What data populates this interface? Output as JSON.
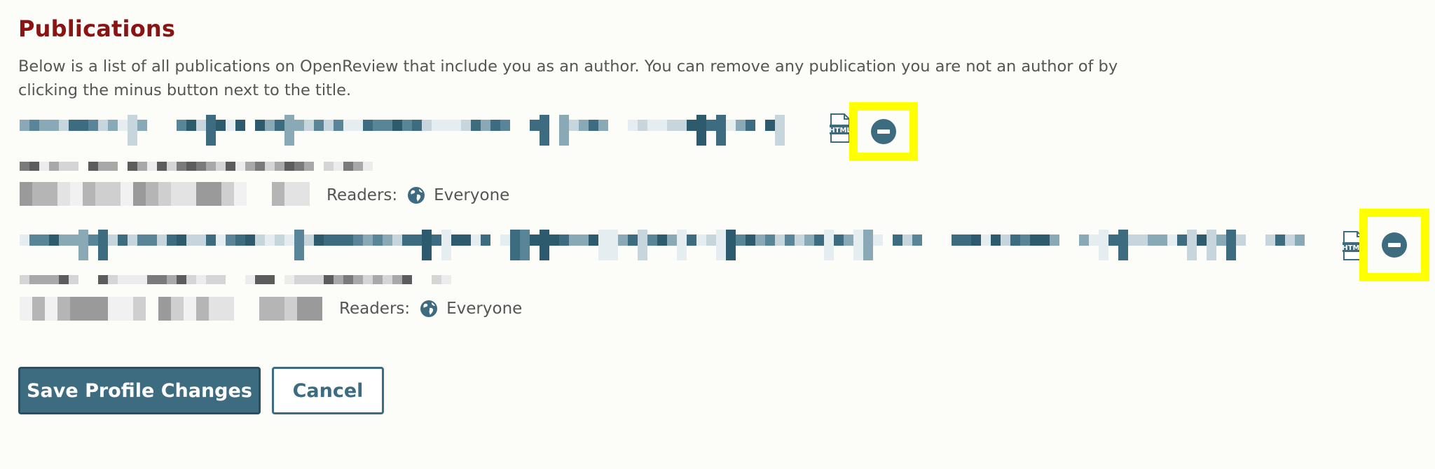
{
  "section": {
    "title": "Publications",
    "description": "Below is a list of all publications on OpenReview that include you as an author. You can remove any publication you are not an author of by clicking the minus button next to the title."
  },
  "publications": [
    {
      "title_redacted": true,
      "authors_redacted": true,
      "venue_redacted": true,
      "readers_label": "Readers:",
      "readers_value": "Everyone",
      "html_icon_label": "HTML",
      "remove_icon": "minus-circle-icon",
      "highlighted": true
    },
    {
      "title_redacted": true,
      "authors_redacted": true,
      "venue_redacted": true,
      "readers_label": "Readers:",
      "readers_value": "Everyone",
      "html_icon_label": "HTML",
      "remove_icon": "minus-circle-icon",
      "highlighted": true
    }
  ],
  "actions": {
    "save_label": "Save Profile Changes",
    "cancel_label": "Cancel"
  },
  "colors": {
    "title": "#8a1414",
    "primary": "#3d6b80",
    "highlight": "#ffff00",
    "background": "#fcfcf9"
  }
}
